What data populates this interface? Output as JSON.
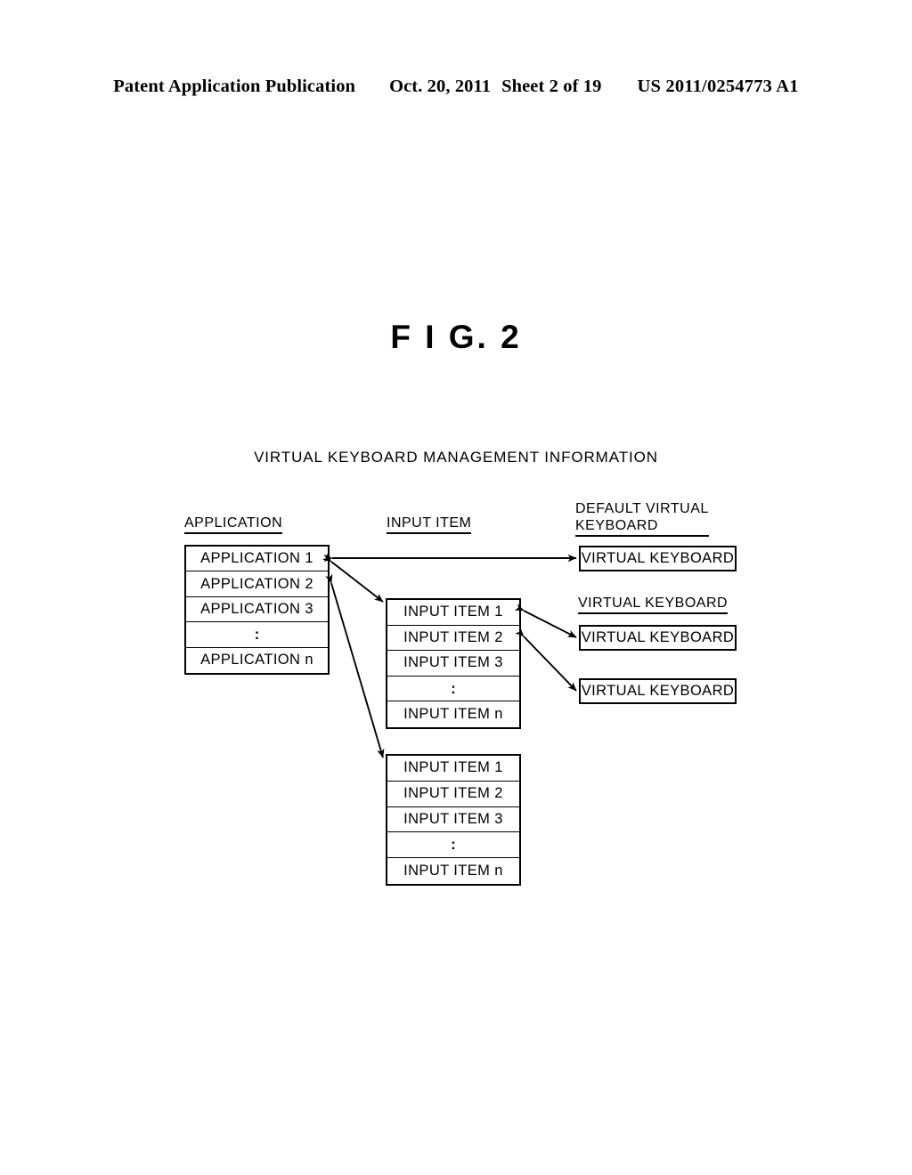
{
  "header": {
    "publication": "Patent Application Publication",
    "date": "Oct. 20, 2011",
    "sheet": "Sheet 2 of 19",
    "patent_number": "US 2011/0254773 A1"
  },
  "figure": {
    "label": "F I G. 2",
    "subtitle": "VIRTUAL KEYBOARD MANAGEMENT INFORMATION"
  },
  "columns": {
    "application": "APPLICATION",
    "input_item": "INPUT ITEM",
    "default_virtual_keyboard_line1": "DEFAULT VIRTUAL",
    "default_virtual_keyboard_line2": "KEYBOARD",
    "virtual_keyboard": "VIRTUAL KEYBOARD"
  },
  "application_table": {
    "rows": [
      "APPLICATION 1",
      "APPLICATION 2",
      "APPLICATION 3",
      ":",
      "APPLICATION n"
    ]
  },
  "input_item_table_1": {
    "rows": [
      "INPUT ITEM 1",
      "INPUT ITEM 2",
      "INPUT ITEM 3",
      ":",
      "INPUT ITEM n"
    ]
  },
  "input_item_table_2": {
    "rows": [
      "INPUT ITEM 1",
      "INPUT ITEM 2",
      "INPUT ITEM 3",
      ":",
      "INPUT ITEM n"
    ]
  },
  "keyboard_boxes": [
    {
      "label": "VIRTUAL KEYBOARD"
    },
    {
      "label": "VIRTUAL KEYBOARD"
    },
    {
      "label": "VIRTUAL KEYBOARD"
    }
  ],
  "colors": {
    "ink": "#000000",
    "paper": "#ffffff"
  }
}
